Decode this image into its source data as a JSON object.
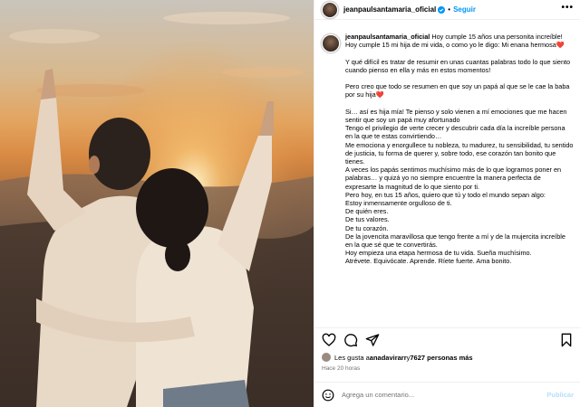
{
  "post": {
    "username": "jeanpaulsantamaria_oficial",
    "follow_label": "Seguir",
    "more_label": "•••",
    "caption_lines": [
      "Hoy cumple 15 años una personita increíble! Hoy cumple 15 mi hija de mi vida, o como yo le digo: Mi enana hermosa❤️",
      "",
      "Y qué difícil es tratar de resumir en unas cuantas palabras todo lo que siento cuando pienso en ella y más en estos momentos!",
      "",
      "Pero creo que todo se resumen en que soy un papá al que se le cae la baba por su hija❤️",
      "",
      "Si… así es hija mía! Te pienso y solo vienen a mí emociones que me hacen sentir que soy un papá muy afortunado",
      "Tengo el privilegio de verte crecer y descubrir cada día la increíble persona en la que te estas convirtiendo…",
      "Me emociona y enorgullece tu nobleza, tu madurez, tu sensibilidad, tu sentido de justicia, tu forma de querer y, sobre todo, ese corazón tan bonito que tienes.",
      "A veces los papás sentimos muchísimo más de lo que logramos poner en palabras… y quizá yo no siempre encuentre la manera perfecta de expresarte la magnitud de lo que siento por ti.",
      "Pero hoy, en tus 15 años, quiero que tú y todo el mundo sepan algo:",
      "Estoy inmensamente orgulloso de ti.",
      "De quién eres.",
      "De tus valores.",
      "De tu corazón.",
      "De la jovencita maravillosa que tengo frente a mí y de la mujercita increíble en la que sé que te convertirás.",
      "Hoy empieza una etapa hermosa de tu vida. Sueña muchísimo.",
      "Atrévete. Equivócate. Aprende. Ríete fuerte. Ama bonito."
    ],
    "likes_prefix": "Les gusta a ",
    "likes_user": "anadavirarr",
    "likes_connector": " y ",
    "likes_count": "7627 personas más",
    "timestamp": "Hace 20 horas",
    "comment_placeholder": "Agrega un comentario...",
    "publish_label": "Publicar",
    "colors": {
      "accent": "#0095f6",
      "publish_disabled": "#b2dffc",
      "heart": "#e0245e"
    },
    "icons": [
      "heart-icon",
      "comment-icon",
      "share-icon",
      "bookmark-icon",
      "emoji-icon",
      "verified-badge-icon",
      "more-options-icon"
    ]
  }
}
